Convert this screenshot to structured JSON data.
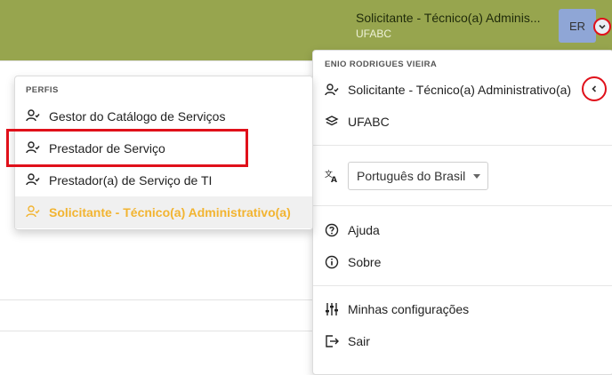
{
  "header": {
    "role_label": "Solicitante - Técnico(a) Adminis...",
    "org_label": "UFABC",
    "avatar_initials": "ER",
    "bar_color": "#97a54e"
  },
  "user_menu": {
    "user_name": "ENIO RODRIGUES VIEIRA",
    "current_profile": "Solicitante - Técnico(a) Administrativo(a)",
    "organization": "UFABC",
    "language_value": "Português do Brasil",
    "items": {
      "help": "Ajuda",
      "about": "Sobre",
      "settings": "Minhas configurações",
      "logout": "Sair"
    }
  },
  "profiles_menu": {
    "header": "PERFIS",
    "items": [
      {
        "label": "Gestor do Catálogo de Serviços"
      },
      {
        "label": "Prestador de Serviço"
      },
      {
        "label": "Prestador(a) de Serviço de TI"
      },
      {
        "label": "Solicitante - Técnico(a) Administrativo(a)",
        "active": true
      }
    ]
  },
  "colors": {
    "active_profile": "#f2b431",
    "annotation_red": "#e0101a"
  }
}
